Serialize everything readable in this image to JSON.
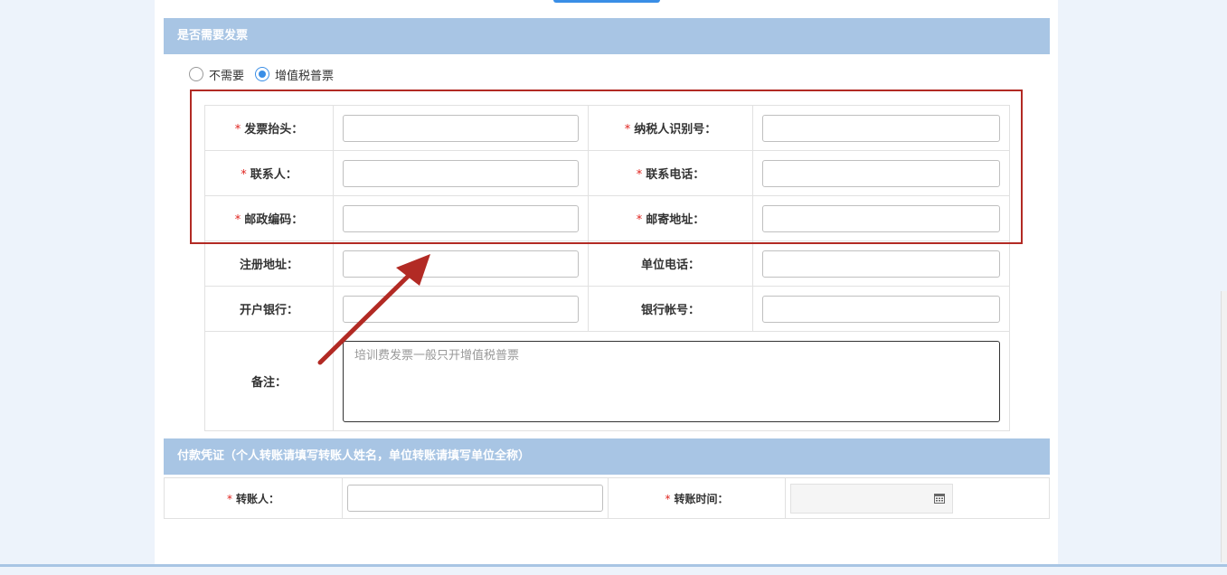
{
  "invoice_section": {
    "title": "是否需要发票",
    "radio_options": [
      {
        "label": "不需要",
        "selected": false
      },
      {
        "label": "增值税普票",
        "selected": true
      }
    ],
    "required_mark": "*",
    "fields": {
      "invoice_title": "发票抬头：",
      "taxpayer_id": "纳税人识别号：",
      "contact": "联系人：",
      "contact_phone": "联系电话：",
      "postal_code": "邮政编码：",
      "mailing_address": "邮寄地址：",
      "registered_address": "注册地址：",
      "company_phone": "单位电话：",
      "bank": "开户银行：",
      "bank_account": "银行帐号：",
      "remark": "备注："
    },
    "remark_placeholder": "培训费发票一般只开增值税普票"
  },
  "payment_section": {
    "title": "付款凭证（个人转账请填写转账人姓名，单位转账请填写单位全称）",
    "fields": {
      "payer": "转账人：",
      "transfer_time": "转账时间："
    }
  },
  "colors": {
    "header_bg": "#a8c5e4",
    "required": "#e0231e",
    "highlight": "#b22a24",
    "accent": "#3a8ee6"
  },
  "icons": [
    "calendar-icon",
    "annotation-arrow"
  ]
}
